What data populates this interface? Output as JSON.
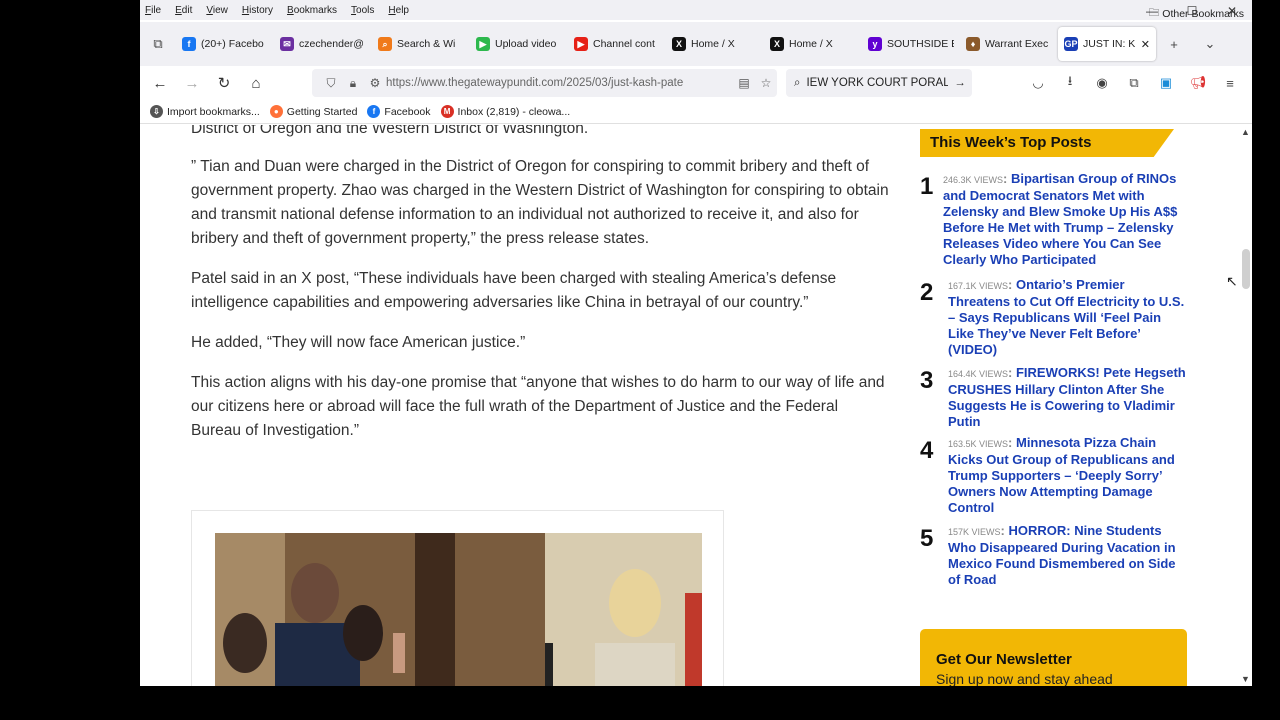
{
  "menubar": {
    "items": [
      {
        "first": "F",
        "rest": "ile"
      },
      {
        "first": "E",
        "rest": "dit"
      },
      {
        "first": "V",
        "rest": "iew"
      },
      {
        "first": "H",
        "rest": "istory"
      },
      {
        "first": "B",
        "rest": "ookmarks"
      },
      {
        "first": "T",
        "rest": "ools"
      },
      {
        "first": "H",
        "rest": "elp"
      }
    ]
  },
  "window_controls": {
    "minimize": "—",
    "maximize": "☐",
    "close": "✕"
  },
  "tabs": [
    {
      "label": "(20+) Facebo",
      "icon": "facebook-icon",
      "color": "#1877f2",
      "glyph": "f"
    },
    {
      "label": "czechender@",
      "icon": "mail-icon",
      "color": "#6b2fa0",
      "glyph": "✉"
    },
    {
      "label": "Search & Wi",
      "icon": "search-wiki-icon",
      "color": "#f07a1a",
      "glyph": "⌕"
    },
    {
      "label": "Upload video",
      "icon": "upload-icon",
      "color": "#2db84d",
      "glyph": "▶"
    },
    {
      "label": "Channel cont",
      "icon": "youtube-icon",
      "color": "#e62117",
      "glyph": "▶"
    },
    {
      "label": "Home / X",
      "icon": "x-icon",
      "color": "#111",
      "glyph": "X"
    },
    {
      "label": "Home / X",
      "icon": "x-icon",
      "color": "#111",
      "glyph": "X"
    },
    {
      "label": "SOUTHSIDE E",
      "icon": "yahoo-icon",
      "color": "#6001d2",
      "glyph": "y"
    },
    {
      "label": "Warrant Exec",
      "icon": "warrant-icon",
      "color": "#8b5a2b",
      "glyph": "♦"
    },
    {
      "label": "JUST IN: K",
      "icon": "gp-icon",
      "color": "#1a3fb5",
      "glyph": "GP",
      "close": "✕"
    }
  ],
  "tab_controls": {
    "new_tab": "+",
    "list_all": "⌄",
    "tab_manager": "⧉"
  },
  "nav": {
    "back": "←",
    "forward": "→",
    "reload": "↻",
    "home": "⌂",
    "url": "https://www.thegatewaypundit.com/2025/03/just-kash-pate",
    "search_text": "IEW YORK COURT PORAL"
  },
  "bookmarks": [
    {
      "label": "Import bookmarks...",
      "icon": "import-icon",
      "color": "#555",
      "glyph": "⇩"
    },
    {
      "label": "Getting Started",
      "icon": "firefox-icon",
      "color": "#ff7139",
      "glyph": "●"
    },
    {
      "label": "Facebook",
      "icon": "facebook-icon",
      "color": "#1877f2",
      "glyph": "f"
    },
    {
      "label": "Inbox (2,819) - cleowa...",
      "icon": "gmail-icon",
      "color": "#d93025",
      "glyph": "M"
    }
  ],
  "other_bookmarks": "Other Bookmarks",
  "article": {
    "cut_line": "District of Oregon and the Western District of Washington.",
    "paragraphs": [
      "” Tian and Duan were charged in the District of Oregon for conspiring to commit bribery and theft of government property. Zhao was charged in the Western District of Washington for conspiring to obtain and transmit national defense information to an individual not authorized to receive it, and also for bribery and theft of government property,” the press release states.",
      "Patel said in an X post, “These individuals have been charged with stealing America’s defense intelligence capabilities and empowering adversaries like China in betrayal of our country.”",
      "He added, “They will now face American justice.”",
      "This action aligns with his day-one promise that “anyone that wishes to do harm to our way of life and our citizens here or abroad will face the full wrath of the Department of Justice and the Federal Bureau of Investigation.”"
    ]
  },
  "sidebar": {
    "heading": "This Week’s Top Posts",
    "posts": [
      {
        "num": "1",
        "views": "246.3K VIEWS",
        "title": "Bipartisan Group of RINOs and Democrat Senators Met with Zelensky and Blew Smoke Up His A$$ Before He Met with Trump – Zelensky Releases Video where You Can See Clearly Who Participated"
      },
      {
        "num": "2",
        "views": "167.1K VIEWS",
        "title": "Ontario’s Premier Threatens to Cut Off Electricity to U.S. – Says Republicans Will ‘Feel Pain Like They’ve Never Felt Before’ (VIDEO)"
      },
      {
        "num": "3",
        "views": "164.4K VIEWS",
        "title": "FIREWORKS! Pete Hegseth CRUSHES Hillary Clinton After She Suggests He is Cowering to Vladimir Putin"
      },
      {
        "num": "4",
        "views": "163.5K VIEWS",
        "title": "Minnesota Pizza Chain Kicks Out Group of Republicans and Trump Supporters – ‘Deeply Sorry’ Owners Now Attempting Damage Control"
      },
      {
        "num": "5",
        "views": "157K VIEWS",
        "title": "HORROR: Nine Students Who Disappeared During Vacation in Mexico Found Dismembered on Side of Road"
      }
    ],
    "newsletter": {
      "heading": "Get Our Newsletter",
      "subtext": "Sign up now and stay ahead"
    }
  },
  "colors": {
    "accent": "#f2b705",
    "link": "#1a3fb5"
  }
}
